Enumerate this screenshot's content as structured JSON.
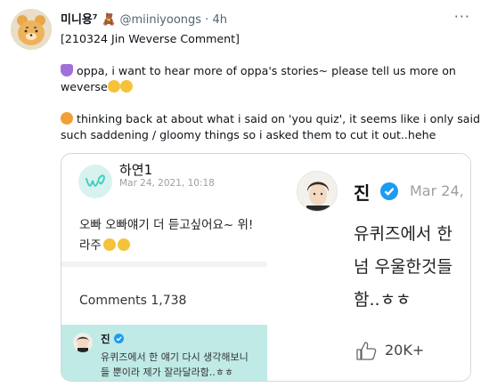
{
  "tweet": {
    "display_name": "미니용⁷ 🧸",
    "handle": "@miiniyoongs",
    "separator": " · ",
    "time": "4h",
    "more_label": "···",
    "lines": [
      "[210324 Jin Weverse Comment]",
      "oppa, i want to hear more of oppa's stories~ please tell us more on",
      "weverse",
      "thinking back at about what i said on 'you quiz', it seems like i only said",
      "such saddening  / gloomy things so i asked them to cut it out..hehe"
    ]
  },
  "quote_image": {
    "left_panel": {
      "username": "하연1",
      "date": "Mar 24, 2021, 10:18",
      "post_lines": [
        "오빠 오빠얘기 더 듣고싶어요~ 위!",
        "라주"
      ],
      "comments_label": "Comments 1,738",
      "reply": {
        "name": "진",
        "lines": [
          "유퀴즈에서 한 얘기 다시 생각해보니",
          "들 뿐이라 제가 잘라달라함..ㅎㅎ"
        ]
      }
    },
    "right_panel": {
      "username": "진",
      "date": "Mar 24,",
      "lines": [
        "유퀴즈에서 한",
        "넘 우울한것들",
        "함..ㅎㅎ"
      ],
      "like_count": "20K+"
    }
  },
  "colors": {
    "purple_heart": "#9b59d0",
    "weverse_teal": "#3ecfc1",
    "verified_blue": "#1d9bf0",
    "reply_bg": "#bfeae6"
  }
}
